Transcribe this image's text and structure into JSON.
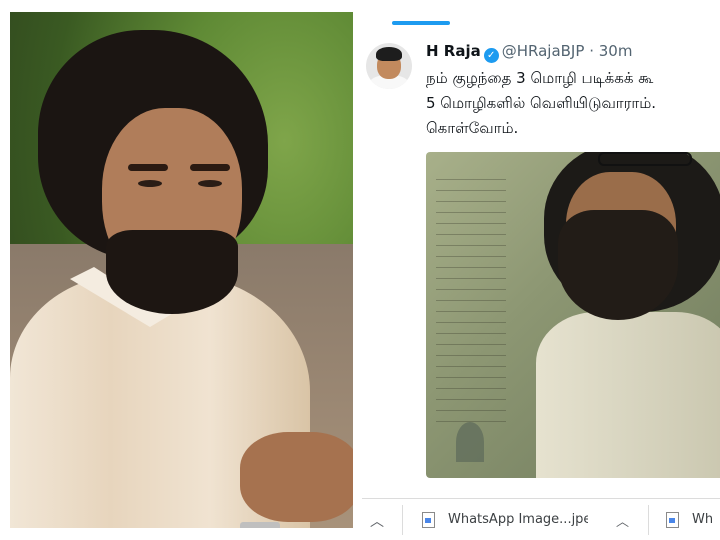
{
  "tweet": {
    "name": "H Raja",
    "handle": "@HRajaBJP",
    "separator": "·",
    "time": "30m",
    "text": "நம் குழந்தை 3 மொழி படிக்கக் கூ\n5 மொழிகளில் வெளியிடுவாராம்.\nகொள்வோம்."
  },
  "download_bar": {
    "items": [
      {
        "label": "WhatsApp Image...jpeg"
      },
      {
        "label": "Wh"
      }
    ]
  },
  "colors": {
    "accent": "#1d9bf0",
    "handle_gray": "#536471"
  },
  "icons": [
    "verified-icon",
    "file-icon",
    "chevron-up-icon"
  ]
}
